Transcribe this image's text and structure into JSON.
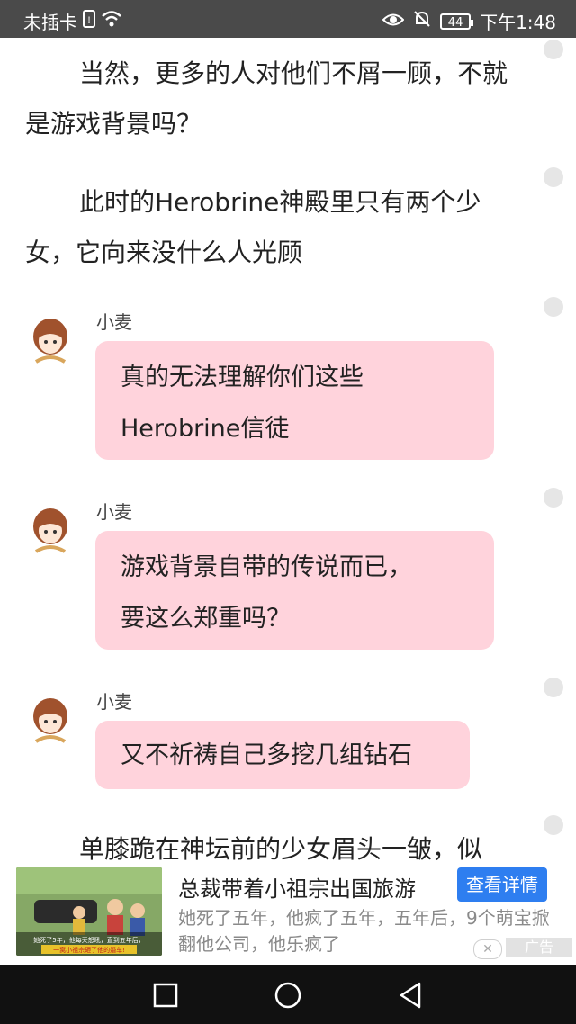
{
  "status_bar": {
    "carrier": "未插卡",
    "battery": "44",
    "time": "下午1:48"
  },
  "story": {
    "paragraph_1": "当然，更多的人对他们不屑一顾，不就是游戏背景吗？",
    "paragraph_2": "此时的Herobrine神殿里只有两个少女，它向来没什么人光顾",
    "paragraph_3": "单膝跪在神坛前的少女眉头一皱，似"
  },
  "messages": [
    {
      "name": "小麦",
      "text_line1": "真的无法理解你们这些",
      "text_line2": "Herobrine信徒"
    },
    {
      "name": "小麦",
      "text_line1": "游戏背景自带的传说而已，",
      "text_line2": "要这么郑重吗？"
    },
    {
      "name": "小麦",
      "text_line1": "又不祈祷自己多挖几组钻石"
    }
  ],
  "ad": {
    "title": "总裁带着小祖宗出国旅游",
    "button": "查看详情",
    "desc": "她死了五年，他疯了五年，五年后，9个萌宝掀翻他公司，他乐疯了",
    "label": "广告",
    "thumb_caption_1": "她死了5年，他每天怒吼，直到五年后，",
    "thumb_caption_2": "一窝小祖宗砸了他的婚车!"
  }
}
